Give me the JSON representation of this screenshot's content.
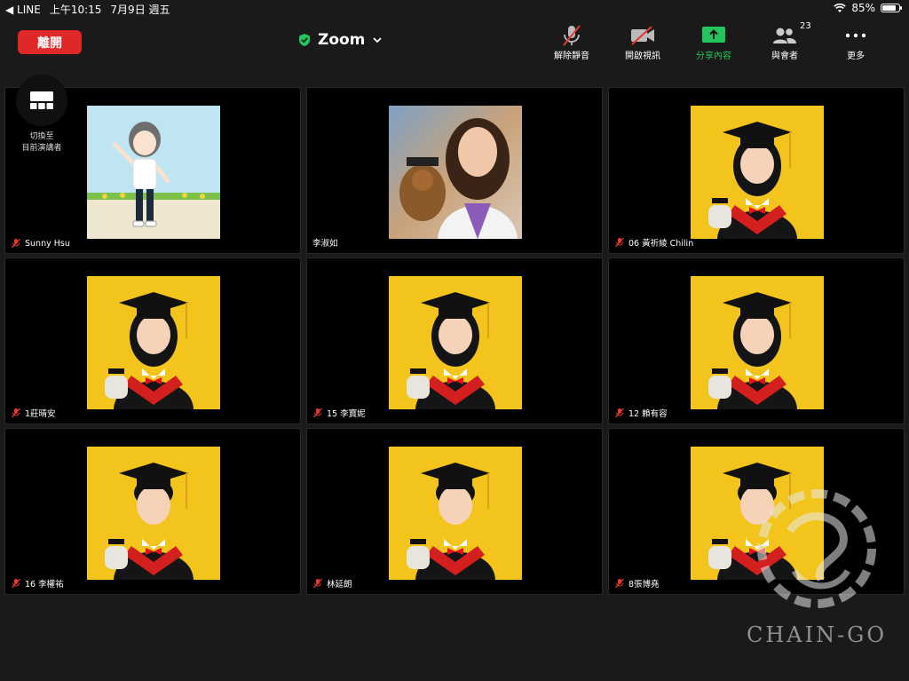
{
  "status_bar": {
    "back_app": "◀ LINE",
    "time": "上午10:15",
    "date": "7月9日 週五",
    "battery": "85%",
    "battery_level": 0.85
  },
  "toolbar": {
    "leave_label": "離開",
    "meeting_title": "Zoom",
    "buttons": {
      "unmute": "解除靜音",
      "start_video": "開啟視訊",
      "share": "分享內容",
      "participants": "與會者",
      "participants_count": "23",
      "more": "更多"
    }
  },
  "switch_view": {
    "line1": "切換至",
    "line2": "目前演講者"
  },
  "participants": [
    {
      "name": "Sunny Hsu",
      "kind": "avatar"
    },
    {
      "name": "李淑如",
      "kind": "portrait",
      "muted": false
    },
    {
      "name": "06 黃祈綾 Chilin",
      "kind": "grad"
    },
    {
      "name": "1莊晴安",
      "kind": "grad"
    },
    {
      "name": "15 李寶妮",
      "kind": "grad"
    },
    {
      "name": "12 賴有容",
      "kind": "grad"
    },
    {
      "name": "16 李權祐",
      "kind": "grad"
    },
    {
      "name": "林延朗",
      "kind": "grad"
    },
    {
      "name": "8張博堯",
      "kind": "grad"
    }
  ],
  "watermark": {
    "text": "CHAIN-GO"
  },
  "colors": {
    "leave": "#e02828",
    "share_green": "#22c55e",
    "mic_off_red": "#e53935",
    "grad_bg": "#f3c51c",
    "gown_red": "#d41f1f"
  }
}
